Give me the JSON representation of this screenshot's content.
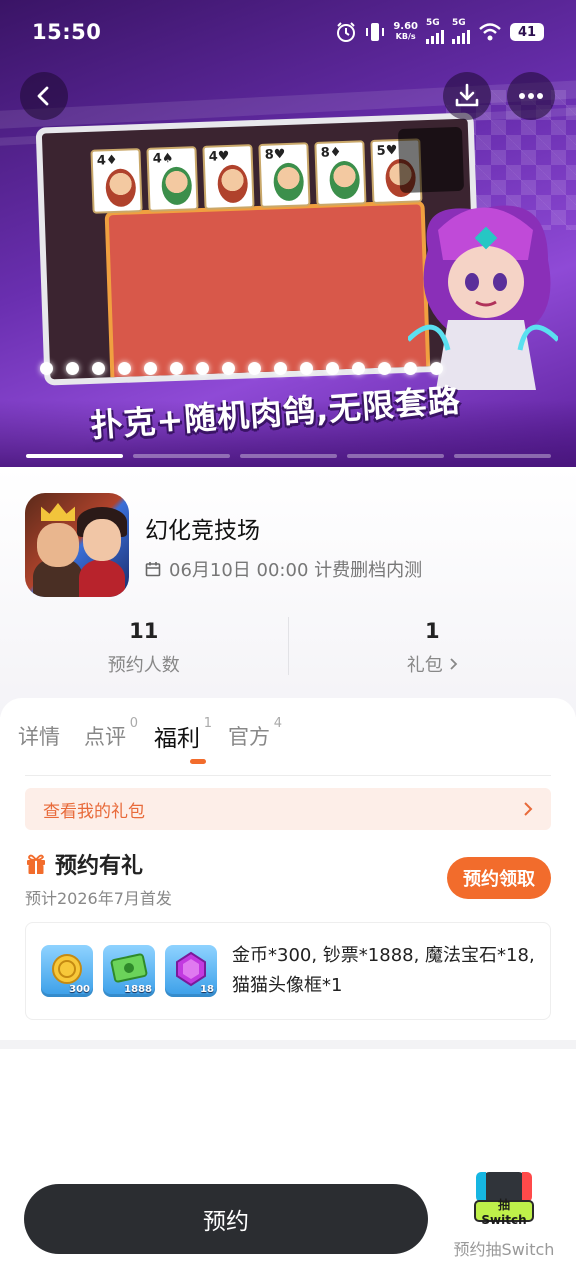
{
  "status_bar": {
    "time": "15:50",
    "net_speed": "9.60",
    "net_unit": "KB/s",
    "sim1": "5G",
    "sim2": "5G",
    "battery": "41"
  },
  "hero": {
    "slogan": "扑克+随机肉鸽,无限套路",
    "page_count": 5,
    "active_page": 1,
    "icons": [
      "back-arrow-icon",
      "download-icon",
      "more-icon"
    ]
  },
  "app": {
    "name": "幻化竞技场",
    "test_info": "06月10日 00:00 计费删档内测",
    "stats": [
      {
        "value": "11",
        "label": "预约人数"
      },
      {
        "value": "1",
        "label": "礼包"
      }
    ]
  },
  "tabs": [
    {
      "label": "详情",
      "count": ""
    },
    {
      "label": "点评",
      "count": "0"
    },
    {
      "label": "福利",
      "count": "1"
    },
    {
      "label": "官方",
      "count": "4"
    }
  ],
  "active_tab": "福利",
  "benefits": {
    "my_gifts_link": "查看我的礼包",
    "reserve_title": "预约有礼",
    "reserve_subtitle": "预计2026年7月首发",
    "claim_button": "预约领取",
    "reward_icons": [
      {
        "name": "coin",
        "qty": "300"
      },
      {
        "name": "banknote",
        "qty": "1888"
      },
      {
        "name": "gem",
        "qty": "18"
      }
    ],
    "reward_text": "金币*300, 钞票*1888, 魔法宝石*18, 猫猫头像框*1"
  },
  "bottom": {
    "reserve_button": "预约",
    "switch_badge": "抽Switch",
    "switch_label": "预约抽Switch"
  },
  "colors": {
    "accent": "#f26c2c",
    "hero_purple": "#6a2fb0",
    "button_dark": "#2b2d31",
    "gift_link_bg": "#fdeee8"
  }
}
